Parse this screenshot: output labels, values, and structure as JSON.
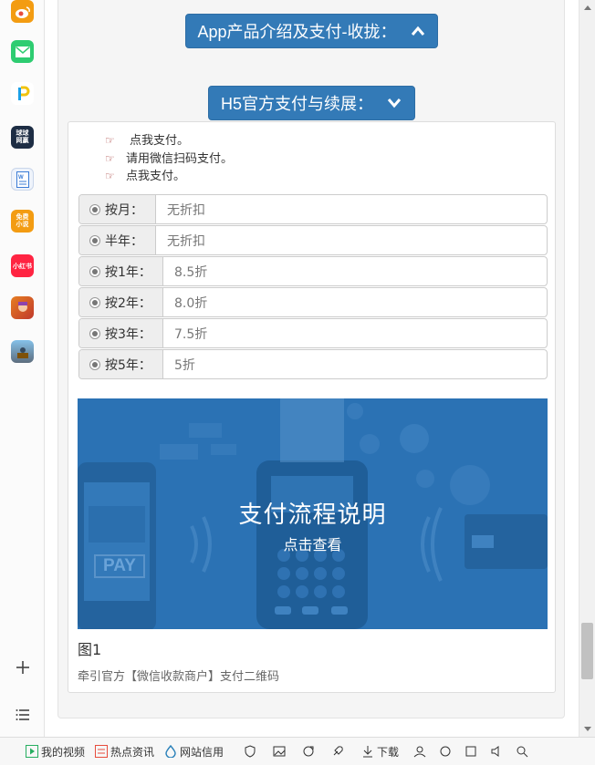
{
  "dock": {
    "apps": [
      {
        "icon": "weibo-icon",
        "color": "#f39c12"
      },
      {
        "icon": "mail-icon",
        "color": "#2ecc71"
      },
      {
        "icon": "p-app-icon",
        "color": "#1aa0e8"
      },
      {
        "icon": "qiuqiu-icon",
        "color": "#1d2d44",
        "label": "球球网赢"
      },
      {
        "icon": "word-doc-icon",
        "color": "#3a7bd5"
      },
      {
        "icon": "free-novel-icon",
        "color": "#f39c12",
        "label": "免费小说"
      },
      {
        "icon": "xiaohongshu-icon",
        "color": "#ff2442",
        "label": "小红书"
      },
      {
        "icon": "game-character-icon",
        "color": "#d35400"
      },
      {
        "icon": "pubg-game-icon",
        "color": "#5d6d7e"
      }
    ]
  },
  "collapse_button": {
    "label": "App产品介绍及支付-收拢：",
    "icon": "chevron-up-icon"
  },
  "h5_button": {
    "label": "H5官方支付与续展：",
    "icon": "chevron-down-icon"
  },
  "pay_links": [
    "点我支付。",
    "请用微信扫码支付。",
    "点我支付。"
  ],
  "pricing_options": [
    {
      "label": "按月：",
      "value": "无折扣"
    },
    {
      "label": "半年：",
      "value": "无折扣"
    },
    {
      "label": "按1年：",
      "value": "8.5折"
    },
    {
      "label": "按2年：",
      "value": "8.0折"
    },
    {
      "label": "按3年：",
      "value": "7.5折"
    },
    {
      "label": "按5年：",
      "value": "5折"
    }
  ],
  "banner": {
    "title": "支付流程说明",
    "subtitle": "点击查看",
    "pay_text": "PAY",
    "color": "#2b72b4"
  },
  "figure": {
    "title": "图1",
    "caption": "牵引官方【微信收款商户】支付二维码"
  },
  "statusbar": {
    "items": [
      "我的视频",
      "热点资讯",
      "网站信用",
      "下载"
    ]
  },
  "colors": {
    "primary_button": "#337ab7",
    "panel_bg": "#f5f5f5"
  }
}
